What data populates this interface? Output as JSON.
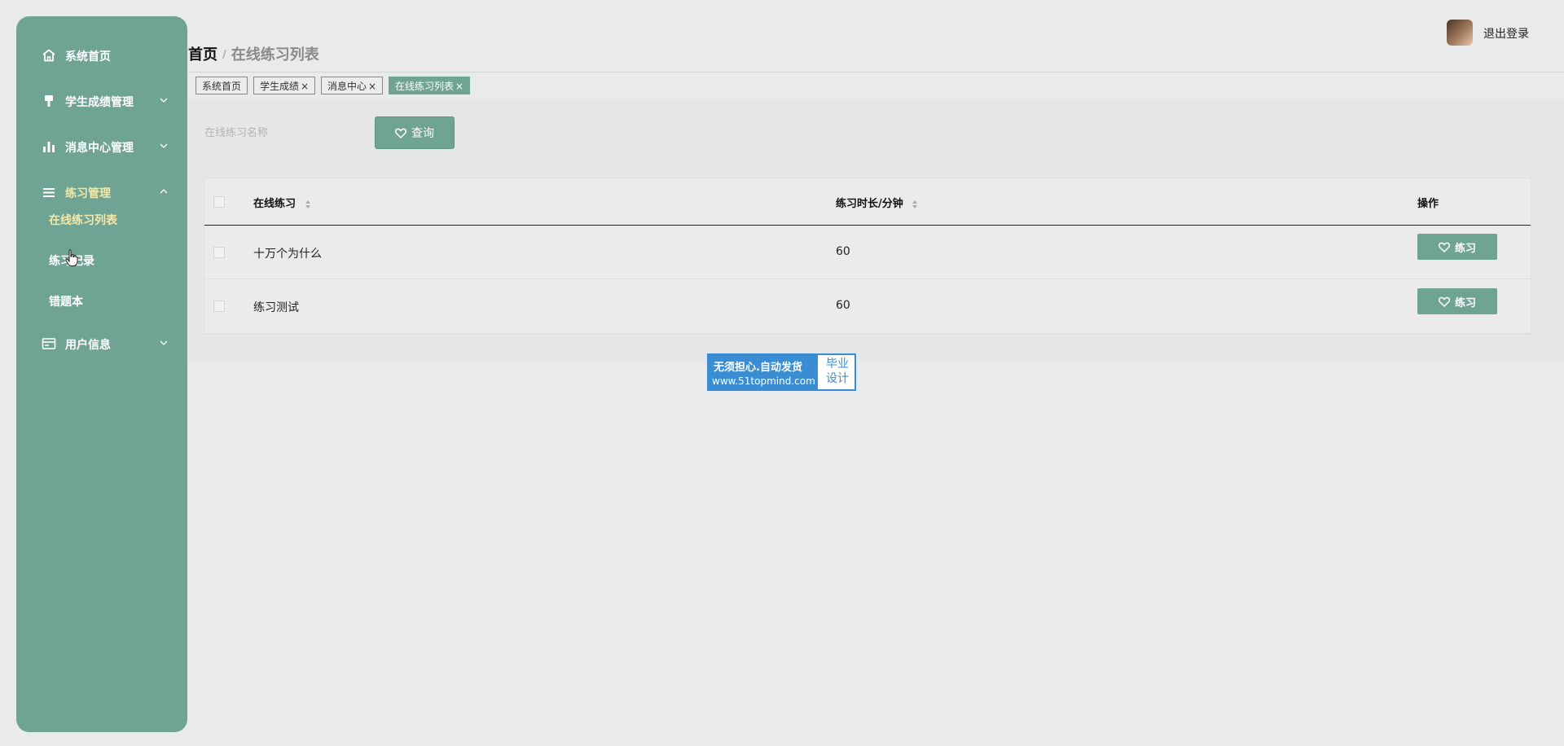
{
  "sidebar": {
    "items": [
      {
        "label": "系统首页",
        "icon": "home-icon"
      },
      {
        "label": "学生成绩管理",
        "icon": "brush-icon"
      },
      {
        "label": "消息中心管理",
        "icon": "bar-chart-icon"
      },
      {
        "label": "练习管理",
        "icon": "list-icon"
      },
      {
        "label": "用户信息",
        "icon": "card-icon"
      }
    ],
    "sub_items": [
      "在线练习列表",
      "练习记录",
      "错题本"
    ]
  },
  "header": {
    "breadcrumb_home": "首页",
    "breadcrumb_sep": "/",
    "breadcrumb_current": "在线练习列表",
    "logout": "退出登录"
  },
  "tags": [
    {
      "label": "系统首页",
      "closable": false
    },
    {
      "label": "学生成绩",
      "closable": true
    },
    {
      "label": "消息中心",
      "closable": true
    },
    {
      "label": "在线练习列表",
      "closable": true
    }
  ],
  "tag_close": "×",
  "search": {
    "placeholder": "在线练习名称",
    "button": "查询"
  },
  "table": {
    "headers": [
      "在线练习",
      "练习时长/分钟",
      "操作"
    ],
    "rows": [
      {
        "name": "十万个为什么",
        "duration": "60",
        "action": "练习"
      },
      {
        "name": "练习测试",
        "duration": "60",
        "action": "练习"
      }
    ]
  },
  "watermark": {
    "line1": "无须担心.自动发货",
    "line2": "www.51topmind.com",
    "right1": "毕业",
    "right2": "设计"
  },
  "colors": {
    "accent": "#6fa393",
    "active_text": "#f4e9a8",
    "badge_blue": "#3a8dd2"
  }
}
